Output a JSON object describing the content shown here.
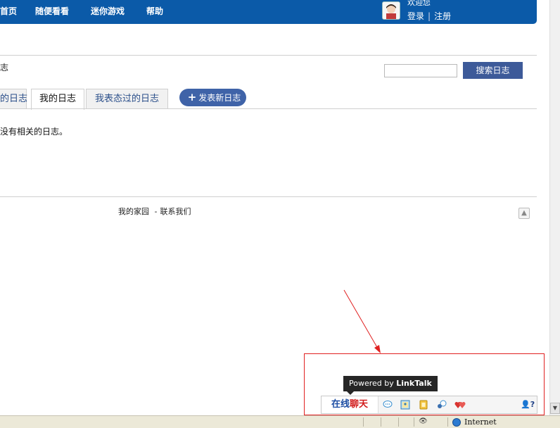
{
  "nav": {
    "items": [
      "首页",
      "随便看看",
      "迷你游戏",
      "帮助"
    ],
    "welcome": "欢迎您",
    "login": "登录",
    "separator": "|",
    "register": "注册"
  },
  "section_title": "志",
  "search": {
    "placeholder": "",
    "button": "搜索日志"
  },
  "tabs": [
    "的日志",
    "我的日志",
    "我表态过的日志"
  ],
  "new_post": "发表新日志",
  "empty_message": "没有相关的日志。",
  "footer": {
    "home": "我的家园",
    "dash": "-",
    "contact": "联系我们"
  },
  "tooltip": {
    "prefix": "Powered by",
    "brand": "LinkTalk"
  },
  "chatbar": {
    "label_part1": "在线",
    "label_part2": "聊天"
  },
  "statusbar": {
    "zone": "Internet"
  },
  "colors": {
    "nav": "#0b5aa8",
    "button": "#3d5a99",
    "annotation": "#e02020"
  }
}
